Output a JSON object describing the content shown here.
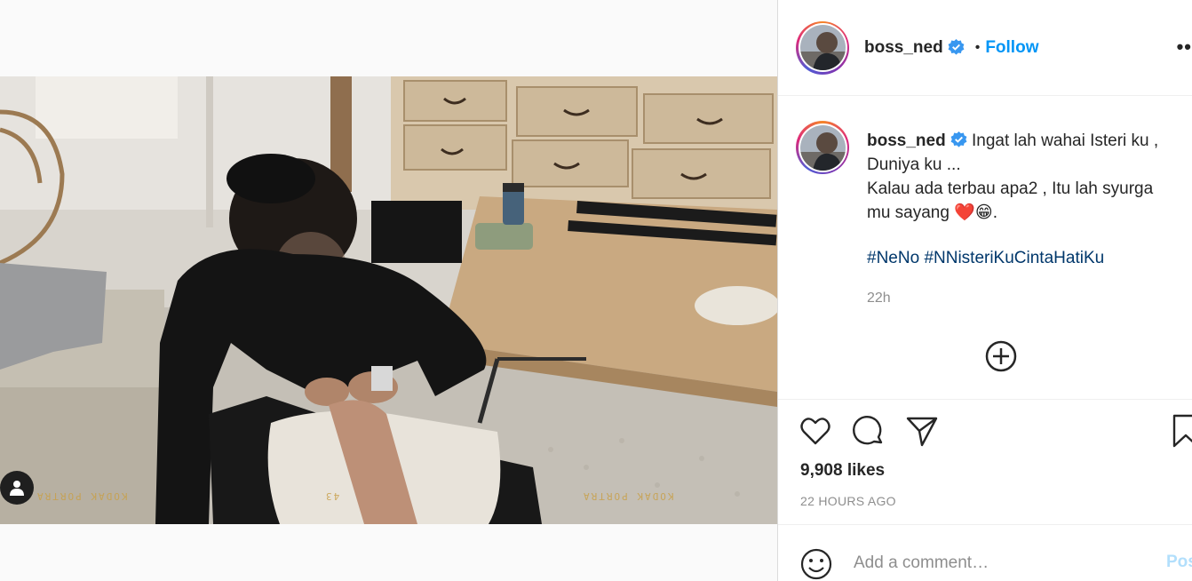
{
  "post": {
    "username": "boss_ned",
    "verified": true,
    "follow_label": "Follow",
    "separator": "•",
    "more_label": "••",
    "caption_line1": "Ingat lah wahai Isteri ku ,",
    "caption_line2": "Duniya ku ...",
    "caption_line3": "Kalau ada terbau apa2 , Itu lah syurga",
    "caption_line4_prefix": "mu sayang",
    "caption_emojis": "❤️😁",
    "caption_line4_suffix": ".",
    "hashtags": [
      "#NeNo",
      "#NNisteriKuCintaHatiKu"
    ],
    "caption_age": "22h",
    "likes": "9,908 likes",
    "posted_ago": "22 HOURS AGO",
    "photo_film_labels": [
      "KODAK PORTRA",
      "KODAK PORTRA",
      "43"
    ]
  },
  "comment": {
    "placeholder": "Add a comment…",
    "post_label": "Post"
  },
  "icons": {
    "like": "heart-icon",
    "comment": "comment-icon",
    "share": "share-icon",
    "save": "bookmark-icon",
    "emoji": "emoji-icon",
    "add": "add-circle-icon",
    "tag": "user-tag-icon",
    "verified": "verified-badge-icon"
  },
  "colors": {
    "follow": "#0095f6",
    "hashtag": "#00376b",
    "verified": "#3897f0",
    "post_disabled": "#b2dffc"
  }
}
